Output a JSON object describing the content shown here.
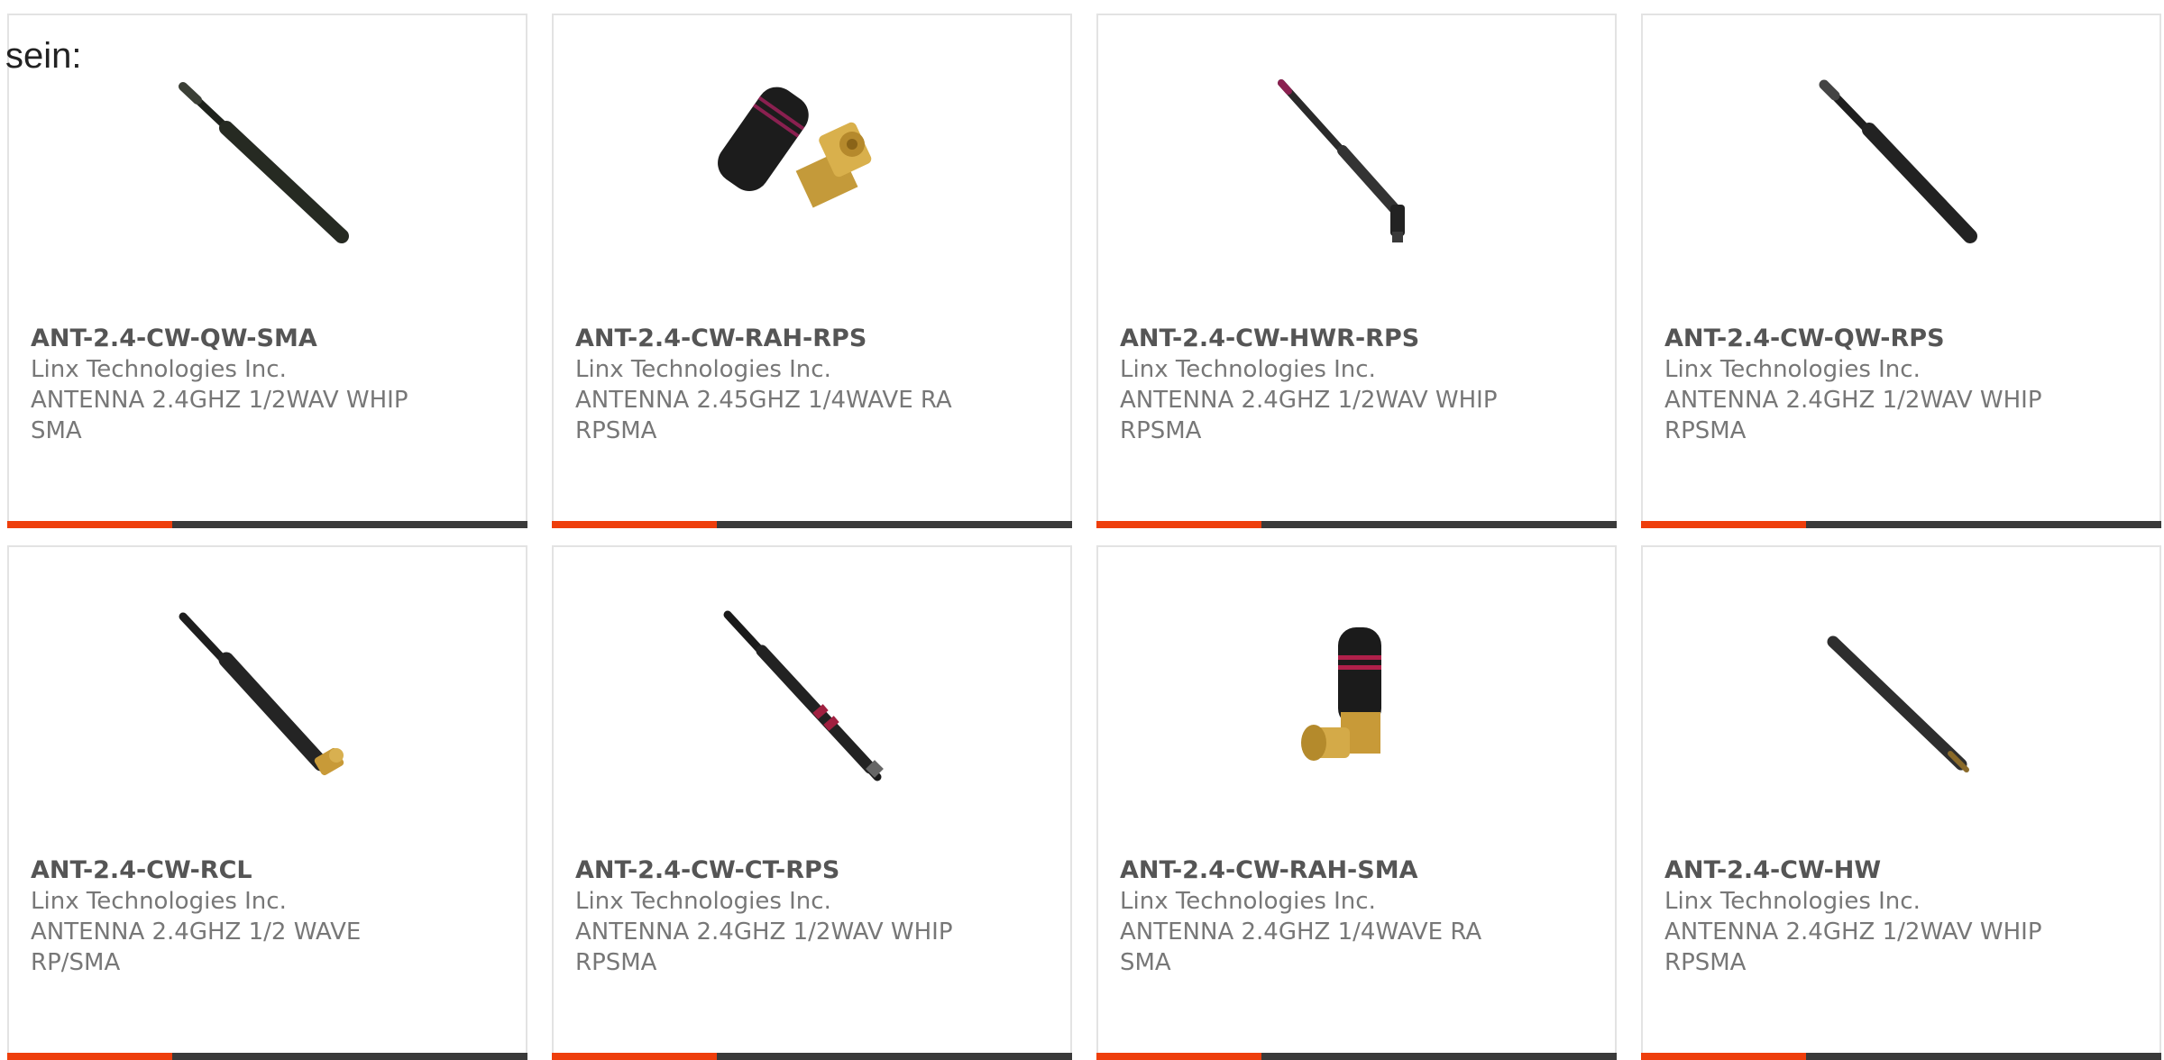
{
  "page": {
    "label": "sein:"
  },
  "colors": {
    "accent": "#ee3e0c",
    "bar": "#3a3a3a",
    "border": "#e3e3e3",
    "title_text": "#555555",
    "body_text": "#777777"
  },
  "products": [
    {
      "part_number": "ANT-2.4-CW-QW-SMA",
      "manufacturer": "Linx Technologies Inc.",
      "description": "ANTENNA 2.4GHZ 1/2WAV WHIP SMA",
      "image_icon": "straight-whip-antenna-icon"
    },
    {
      "part_number": "ANT-2.4-CW-RAH-RPS",
      "manufacturer": "Linx Technologies Inc.",
      "description": "ANTENNA 2.45GHZ 1/4WAVE RA RPSMA",
      "image_icon": "right-angle-stub-antenna-icon"
    },
    {
      "part_number": "ANT-2.4-CW-HWR-RPS",
      "manufacturer": "Linx Technologies Inc.",
      "description": "ANTENNA 2.4GHZ 1/2WAV WHIP RPSMA",
      "image_icon": "hinged-whip-antenna-icon"
    },
    {
      "part_number": "ANT-2.4-CW-QW-RPS",
      "manufacturer": "Linx Technologies Inc.",
      "description": "ANTENNA 2.4GHZ 1/2WAV WHIP RPSMA",
      "image_icon": "straight-whip-antenna-icon"
    },
    {
      "part_number": "ANT-2.4-CW-RCL",
      "manufacturer": "Linx Technologies Inc.",
      "description": "ANTENNA 2.4GHZ 1/2 WAVE RP/SMA",
      "image_icon": "whip-antenna-gold-connector-icon"
    },
    {
      "part_number": "ANT-2.4-CW-CT-RPS",
      "manufacturer": "Linx Technologies Inc.",
      "description": "ANTENNA 2.4GHZ 1/2WAV WHIP RPSMA",
      "image_icon": "whip-antenna-red-stripe-icon"
    },
    {
      "part_number": "ANT-2.4-CW-RAH-SMA",
      "manufacturer": "Linx Technologies Inc.",
      "description": "ANTENNA 2.4GHZ 1/4WAVE RA SMA",
      "image_icon": "right-angle-stub-antenna-icon"
    },
    {
      "part_number": "ANT-2.4-CW-HW",
      "manufacturer": "Linx Technologies Inc.",
      "description": "ANTENNA 2.4GHZ 1/2WAV WHIP RPSMA",
      "image_icon": "straight-whip-antenna-icon"
    }
  ]
}
